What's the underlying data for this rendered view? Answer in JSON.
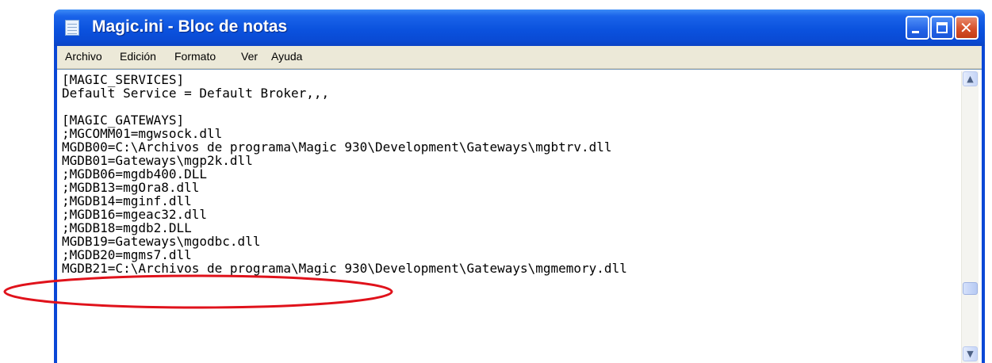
{
  "window": {
    "title": "Magic.ini - Bloc de notas",
    "controls": {
      "minimize": "",
      "maximize": "",
      "close": "✕"
    }
  },
  "menubar": {
    "items": [
      "Archivo",
      "Edición",
      "Formato",
      "Ver",
      "Ayuda"
    ]
  },
  "editor": {
    "lines": [
      "[MAGIC_SERVICES]",
      "Default Service = Default Broker,,,",
      "",
      "[MAGIC_GATEWAYS]",
      ";MGCOMM01=mgwsock.dll",
      "MGDB00=C:\\Archivos de programa\\Magic 930\\Development\\Gateways\\mgbtrv.dll",
      "MGDB01=Gateways\\mgp2k.dll",
      ";MGDB06=mgdb400.DLL",
      ";MGDB13=mgOra8.dll",
      ";MGDB14=mginf.dll",
      ";MGDB16=mgeac32.dll",
      ";MGDB18=mgdb2.DLL",
      "MGDB19=Gateways\\mgodbc.dll",
      ";MGDB20=mgms7.dll",
      "MGDB21=C:\\Archivos de programa\\Magic 930\\Development\\Gateways\\mgmemory.dll"
    ]
  },
  "scrollbar": {
    "up_arrow": "▲",
    "down_arrow": "▼"
  },
  "annotation": {
    "color": "#e0121b",
    "target_line": "MGDB19=Gateways\\mgodbc.dll"
  }
}
